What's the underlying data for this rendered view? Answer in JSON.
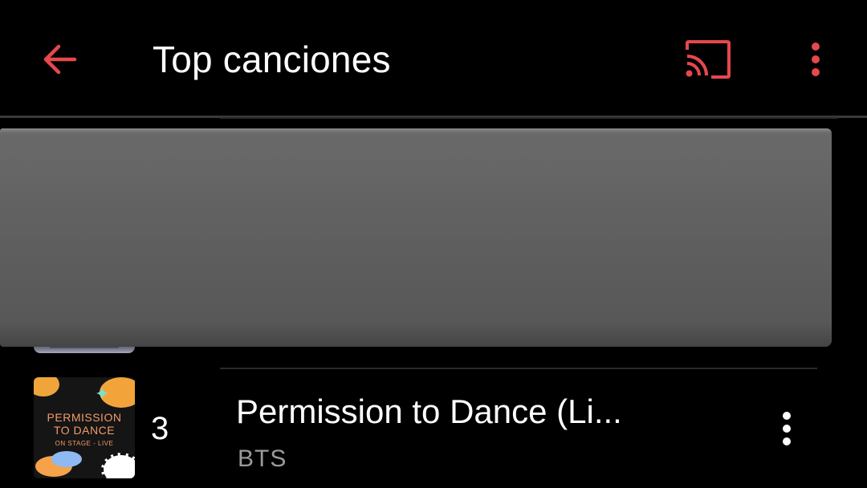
{
  "header": {
    "title": "Top canciones",
    "back_icon": "arrow-left-icon",
    "cast_icon": "cast-icon",
    "menu_icon": "more-vert-icon"
  },
  "colors": {
    "accent": "#e5484d",
    "background": "#000000",
    "overlay": "#5f5f5f",
    "secondary_text": "#9a9a9a"
  },
  "songs": [
    {
      "rank": "3",
      "title": "Permission to Dance (Li...",
      "artist": "BTS",
      "album_art": {
        "line1": "PERMISSION",
        "line2": "TO DANCE",
        "line3": "ON STAGE - LIVE"
      }
    }
  ]
}
